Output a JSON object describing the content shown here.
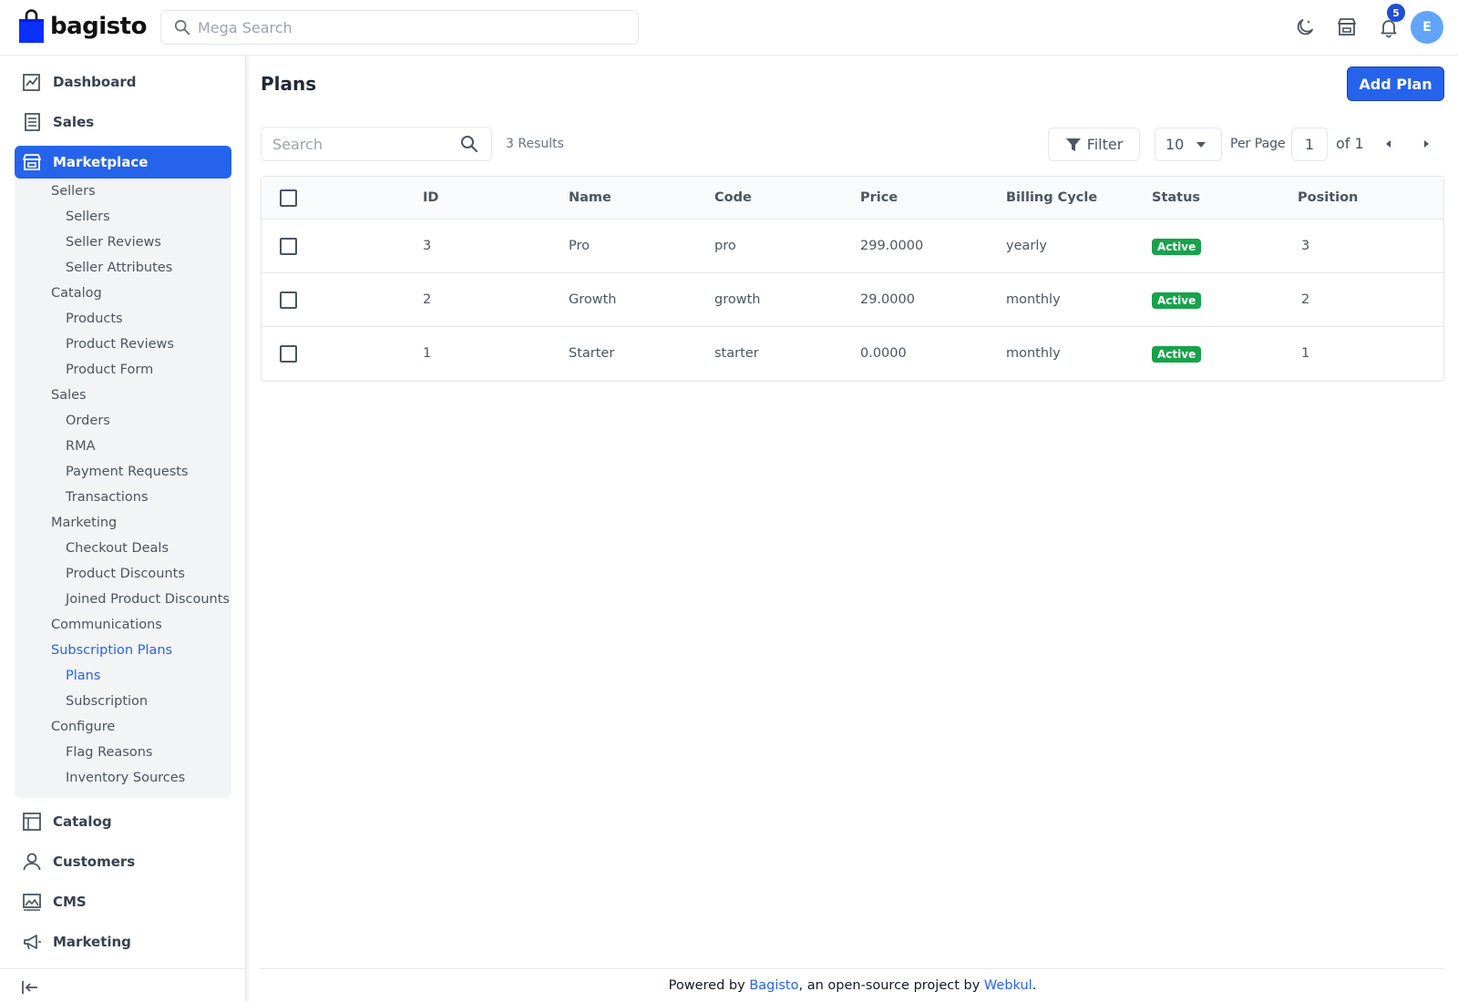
{
  "brand": {
    "name": "bagisto",
    "accent": "#2563eb"
  },
  "header": {
    "search_placeholder": "Mega Search",
    "notification_count": "5",
    "avatar_initial": "E"
  },
  "sidebar": {
    "top_items": [
      {
        "label": "Dashboard",
        "icon": "dashboard-icon"
      },
      {
        "label": "Sales",
        "icon": "receipt-icon"
      },
      {
        "label": "Marketplace",
        "icon": "store-icon",
        "active": true
      }
    ],
    "marketplace_menu": {
      "sellers": "Sellers",
      "sellers_items": [
        "Sellers",
        "Seller Reviews",
        "Seller Attributes"
      ],
      "catalog": "Catalog",
      "catalog_items": [
        "Products",
        "Product Reviews",
        "Product Form"
      ],
      "sales": "Sales",
      "sales_items": [
        "Orders",
        "RMA",
        "Payment Requests",
        "Transactions"
      ],
      "marketing": "Marketing",
      "marketing_items": [
        "Checkout Deals",
        "Product Discounts",
        "Joined Product Discounts"
      ],
      "communications": "Communications",
      "subscription_plans": "Subscription Plans",
      "subscription_items": [
        "Plans",
        "Subscription"
      ],
      "configure": "Configure",
      "configure_items": [
        "Flag Reasons",
        "Inventory Sources"
      ]
    },
    "bottom_items": [
      {
        "label": "Catalog",
        "icon": "catalog-icon"
      },
      {
        "label": "Customers",
        "icon": "user-icon"
      },
      {
        "label": "CMS",
        "icon": "cms-icon"
      },
      {
        "label": "Marketing",
        "icon": "megaphone-icon"
      }
    ]
  },
  "main": {
    "title": "Plans",
    "add_button": "Add Plan",
    "search_placeholder": "Search",
    "results": "3 Results",
    "filter_label": "Filter",
    "per_page_value": "10",
    "per_page_label": "Per Page",
    "page": "1",
    "of_pages": "of 1",
    "columns": [
      "ID",
      "Name",
      "Code",
      "Price",
      "Billing Cycle",
      "Status",
      "Position"
    ],
    "rows": [
      {
        "id": "3",
        "name": "Pro",
        "code": "pro",
        "price": "299.0000",
        "cycle": "yearly",
        "status": "Active",
        "position": "3"
      },
      {
        "id": "2",
        "name": "Growth",
        "code": "growth",
        "price": "29.0000",
        "cycle": "monthly",
        "status": "Active",
        "position": "2"
      },
      {
        "id": "1",
        "name": "Starter",
        "code": "starter",
        "price": "0.0000",
        "cycle": "monthly",
        "status": "Active",
        "position": "1"
      }
    ]
  },
  "footer": {
    "prefix": "Powered by ",
    "link1": "Bagisto",
    "middle": ", an open-source project by ",
    "link2": "Webkul",
    "suffix": "."
  }
}
